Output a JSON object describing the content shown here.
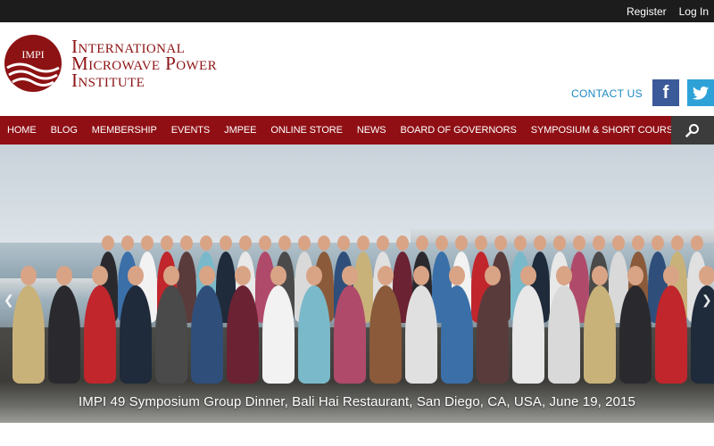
{
  "topbar": {
    "register": "Register",
    "login": "Log In"
  },
  "brand": {
    "logo_text": "IMPI",
    "name_line1": "International",
    "name_line2": "Microwave Power",
    "name_line3": "Institute",
    "color": "#8d1213"
  },
  "header": {
    "contact_label": "CONTACT US",
    "facebook_glyph": "f",
    "twitter_icon": "twitter-bird-icon"
  },
  "nav": {
    "items": [
      "HOME",
      "BLOG",
      "MEMBERSHIP",
      "EVENTS",
      "JMPEE",
      "ONLINE STORE",
      "NEWS",
      "BOARD OF GOVERNORS",
      "SYMPOSIUM & SHORT COURSES"
    ],
    "search_icon": "search-icon",
    "bg_color": "#8f0f14"
  },
  "slider": {
    "caption": "IMPI 49 Symposium Group Dinner, Bali Hai Restaurant, San Diego, CA, USA, June 19, 2015",
    "prev_glyph": "❮",
    "next_glyph": "❯"
  }
}
